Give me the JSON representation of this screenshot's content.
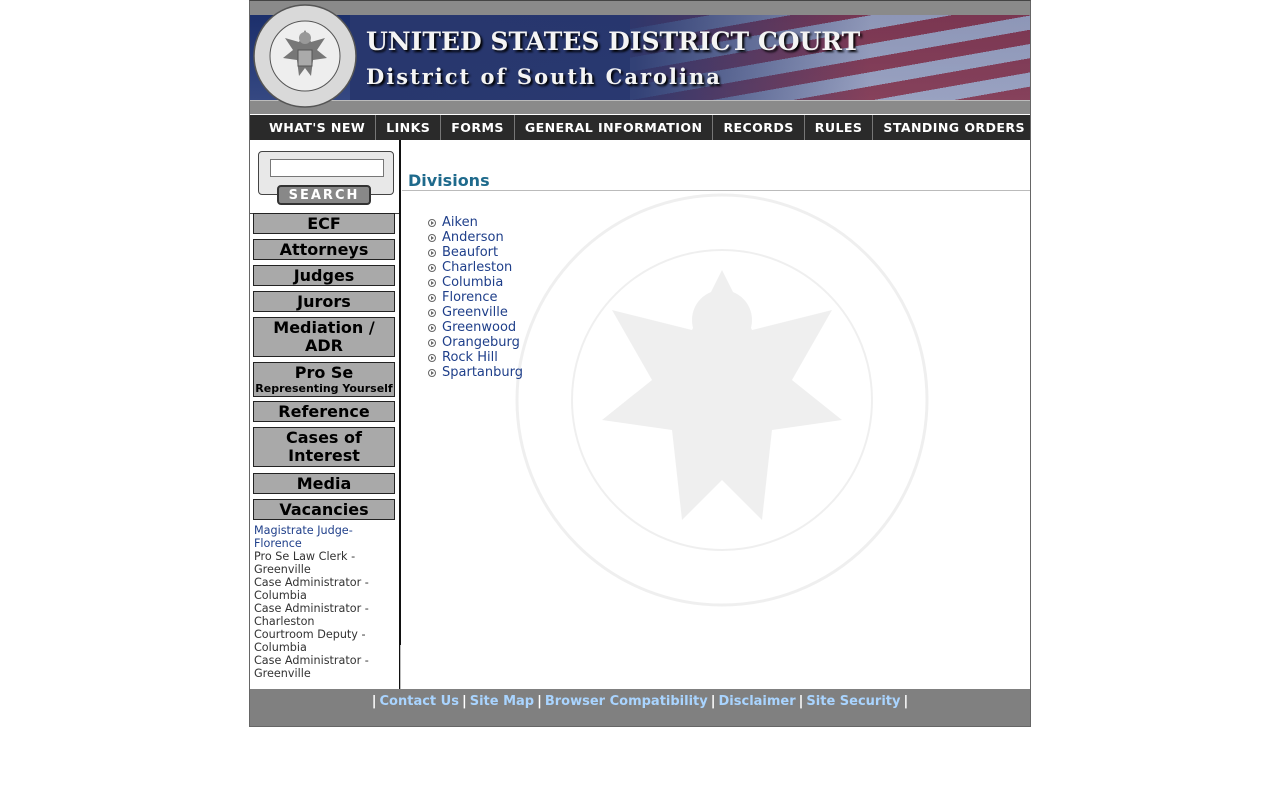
{
  "header": {
    "title": "UNITED STATES DISTRICT COURT",
    "subtitle": "District of South Carolina",
    "seal_text": "UNITED STATES DISTRICT COURT · DISTRICT OF SOUTH CAROLINA"
  },
  "nav": {
    "items": [
      "WHAT'S NEW",
      "LINKS",
      "FORMS",
      "GENERAL INFORMATION",
      "RECORDS",
      "RULES",
      "STANDING ORDERS"
    ]
  },
  "search": {
    "value": "",
    "button_label": "SEARCH"
  },
  "sidebar": {
    "buttons": [
      {
        "label": "ECF"
      },
      {
        "label": "Attorneys"
      },
      {
        "label": "Judges"
      },
      {
        "label": "Jurors"
      },
      {
        "label": "Mediation / ADR"
      },
      {
        "label": "Pro Se",
        "sub": "Representing Yourself"
      },
      {
        "label": "Reference"
      },
      {
        "label": "Cases of Interest"
      },
      {
        "label": "Media"
      },
      {
        "label": "Vacancies"
      }
    ],
    "vacancies": [
      {
        "text": "Magistrate Judge- Florence",
        "link": true
      },
      {
        "text": "Pro Se Law Clerk - Greenville",
        "link": false
      },
      {
        "text": "Case Administrator - Columbia",
        "link": false
      },
      {
        "text": "Case Administrator - Charleston",
        "link": false
      },
      {
        "text": "Courtroom Deputy - Columbia",
        "link": false
      },
      {
        "text": "Case Administrator - Greenville",
        "link": false
      }
    ]
  },
  "main": {
    "section_title": "Divisions",
    "divisions": [
      "Aiken",
      "Anderson",
      "Beaufort",
      "Charleston",
      "Columbia",
      "Florence",
      "Greenville",
      "Greenwood",
      "Orangeburg",
      "Rock Hill",
      "Spartanburg"
    ]
  },
  "footer": {
    "links": [
      "Contact Us",
      "Site Map",
      "Browser Compatibility",
      "Disclaimer",
      "Site Security"
    ]
  },
  "colors": {
    "nav_bg": "#2a2a2a",
    "sidebar_button_bg": "#a9a9a9",
    "section_title": "#1f6a8c",
    "link": "#1f3f8a",
    "footer_bg": "#808080",
    "footer_link": "#a9d4ff"
  }
}
